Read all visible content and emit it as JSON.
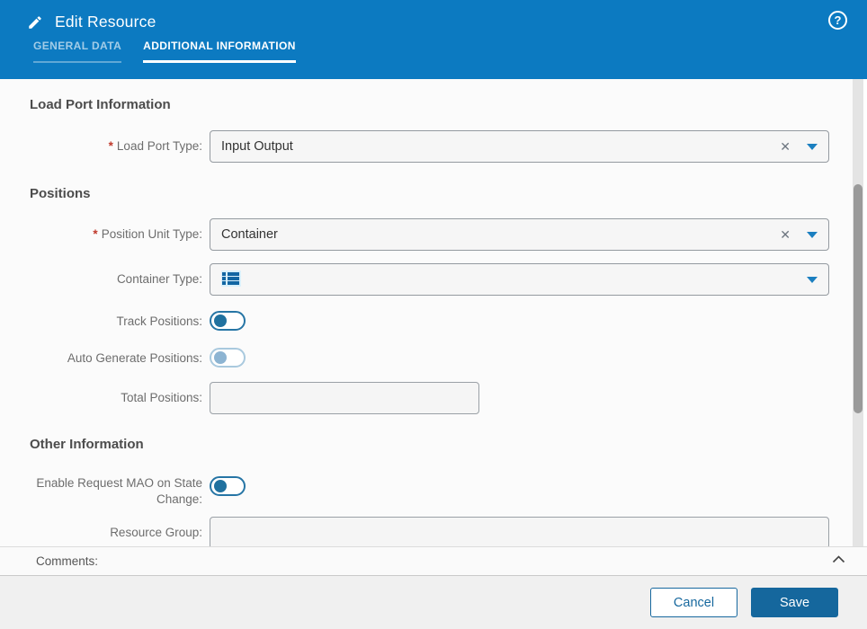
{
  "header": {
    "title": "Edit Resource",
    "help_glyph": "?",
    "tabs": [
      {
        "label": "GENERAL DATA",
        "active": false
      },
      {
        "label": "ADDITIONAL INFORMATION",
        "active": true
      }
    ]
  },
  "form": {
    "required_marker": "*",
    "sections": [
      {
        "title": "Load Port Information"
      },
      {
        "title": "Positions"
      },
      {
        "title": "Other Information"
      }
    ],
    "fields": {
      "load_port_type": {
        "label": "Load Port Type:",
        "required": true,
        "value": "Input Output",
        "type": "dropdown",
        "clear_glyph": "✕"
      },
      "position_unit_type": {
        "label": "Position Unit Type:",
        "required": true,
        "value": "Container",
        "type": "dropdown",
        "clear_glyph": "✕"
      },
      "container_type": {
        "label": "Container Type:",
        "value": "",
        "type": "dropdown",
        "icon": "list-icon"
      },
      "track_positions": {
        "label": "Track Positions:",
        "type": "toggle",
        "state": "off",
        "enabled": true
      },
      "auto_generate_positions": {
        "label": "Auto Generate Positions:",
        "type": "toggle",
        "state": "off",
        "enabled": false
      },
      "total_positions": {
        "label": "Total Positions:",
        "value": "",
        "type": "text"
      },
      "enable_request_mao": {
        "label": "Enable Request MAO on State Change:",
        "type": "toggle",
        "state": "off",
        "enabled": true
      },
      "resource_group": {
        "label": "Resource Group:",
        "value": "",
        "type": "text"
      }
    }
  },
  "comments": {
    "label": "Comments:"
  },
  "footer": {
    "cancel_label": "Cancel",
    "save_label": "Save"
  },
  "colors": {
    "header_blue": "#0c7ac1",
    "save_blue": "#15679d",
    "toggle_blue": "#20719f",
    "caret_blue": "#1b7fc0",
    "required_red": "#c0392b"
  }
}
